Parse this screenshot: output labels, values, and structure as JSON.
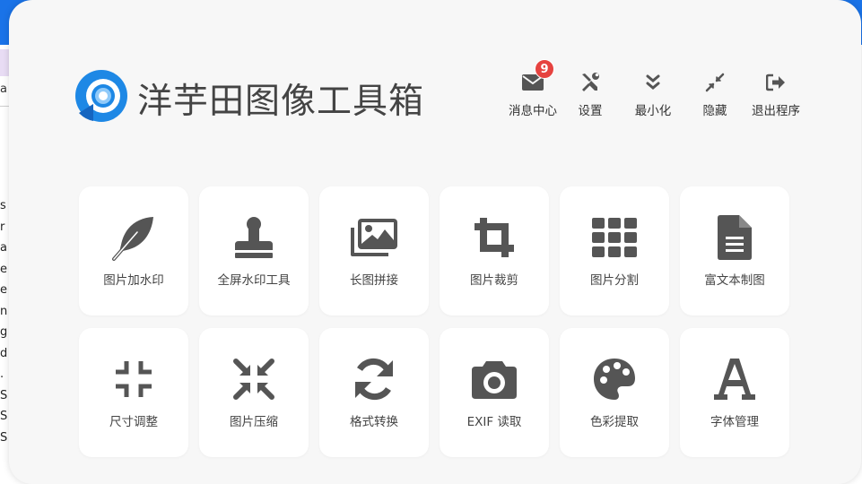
{
  "app": {
    "title": "洋芋田图像工具箱"
  },
  "header": {
    "actions": [
      {
        "id": "messages",
        "label": "消息中心",
        "icon": "envelope-icon",
        "badge": "9"
      },
      {
        "id": "settings",
        "label": "设置",
        "icon": "tools-icon"
      },
      {
        "id": "minimize",
        "label": "最小化",
        "icon": "double-chevron-down-icon"
      },
      {
        "id": "hide",
        "label": "隐藏",
        "icon": "compress-arrows-icon"
      },
      {
        "id": "exit",
        "label": "退出程序",
        "icon": "sign-out-icon"
      }
    ]
  },
  "tools": [
    {
      "label": "图片加水印",
      "icon": "feather-icon"
    },
    {
      "label": "全屏水印工具",
      "icon": "stamp-icon"
    },
    {
      "label": "长图拼接",
      "icon": "images-icon"
    },
    {
      "label": "图片裁剪",
      "icon": "crop-icon"
    },
    {
      "label": "图片分割",
      "icon": "grid-icon"
    },
    {
      "label": "富文本制图",
      "icon": "file-text-icon"
    },
    {
      "label": "尺寸调整",
      "icon": "compress-icon"
    },
    {
      "label": "图片压缩",
      "icon": "compress-arrows-alt-icon"
    },
    {
      "label": "格式转换",
      "icon": "sync-icon"
    },
    {
      "label": "EXIF 读取",
      "icon": "camera-icon"
    },
    {
      "label": "色彩提取",
      "icon": "palette-icon"
    },
    {
      "label": "字体管理",
      "icon": "font-icon"
    }
  ],
  "background": {
    "side_letters": [
      "s",
      "r",
      "a",
      "e",
      "e",
      "n",
      "g",
      "d",
      ".",
      "S",
      "S",
      "S"
    ],
    "top_letter": "a"
  },
  "colors": {
    "icon": "#555555",
    "badge": "#e64340",
    "logo_blue": "#1e88e5",
    "window_bg": "#f7f7f7",
    "tile_bg": "#ffffff"
  }
}
